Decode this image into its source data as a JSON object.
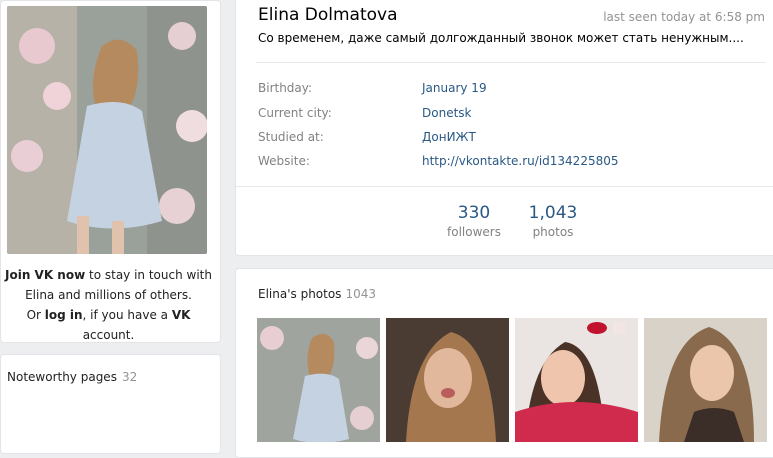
{
  "left": {
    "join": {
      "strong1": "Join VK now",
      "text1": " to stay in touch with Elina and millions of others.",
      "text2": "Or ",
      "login": "log in",
      "text3": ", if you have a ",
      "vk": "VK",
      "text4": " account."
    },
    "noteworthy": {
      "title": "Noteworthy pages",
      "count": "32"
    }
  },
  "profile": {
    "name": "Elina Dolmatova",
    "last_seen": "last seen today at 6:58 pm",
    "status": "Со временем, даже самый долгожданный звонок может стать ненужным....",
    "info": [
      {
        "label": "Birthday:",
        "value": "January 19"
      },
      {
        "label": "Current city:",
        "value": "Donetsk"
      },
      {
        "label": "Studied at:",
        "value": "ДонИЖТ"
      },
      {
        "label": "Website:",
        "value": "http://vkontakte.ru/id134225805"
      }
    ],
    "counters": [
      {
        "num": "330",
        "label": "followers"
      },
      {
        "num": "1,043",
        "label": "photos"
      }
    ]
  },
  "photos": {
    "title": "Elina's photos",
    "count": "1043"
  },
  "colors": {
    "link": "#2a5885",
    "muted": "#828282",
    "page_bg": "#edeef0"
  }
}
